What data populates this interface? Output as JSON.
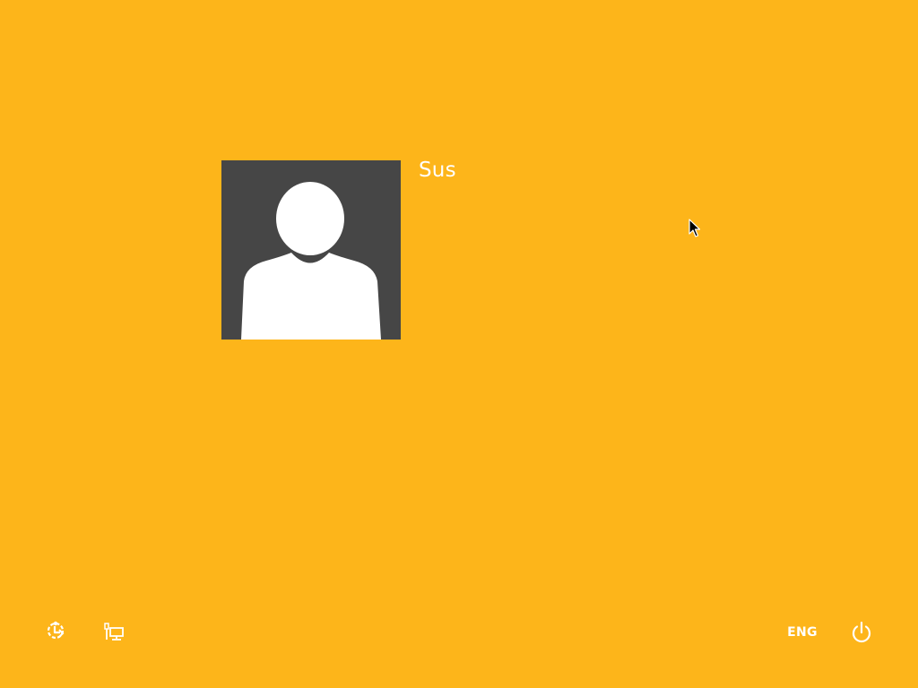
{
  "screen": {
    "type": "windows-8-lock-screen",
    "background_color": "#FDB51A"
  },
  "user": {
    "name": "Sus",
    "avatar_icon": "default-user-avatar-icon",
    "avatar_bg_color": "#464646"
  },
  "bottom_bar": {
    "ease_of_access_icon": "ease-of-access-icon",
    "network_icon": "network-icon",
    "language": "ENG",
    "power_icon": "power-icon"
  },
  "pointer": {
    "icon": "mouse-cursor-icon"
  }
}
